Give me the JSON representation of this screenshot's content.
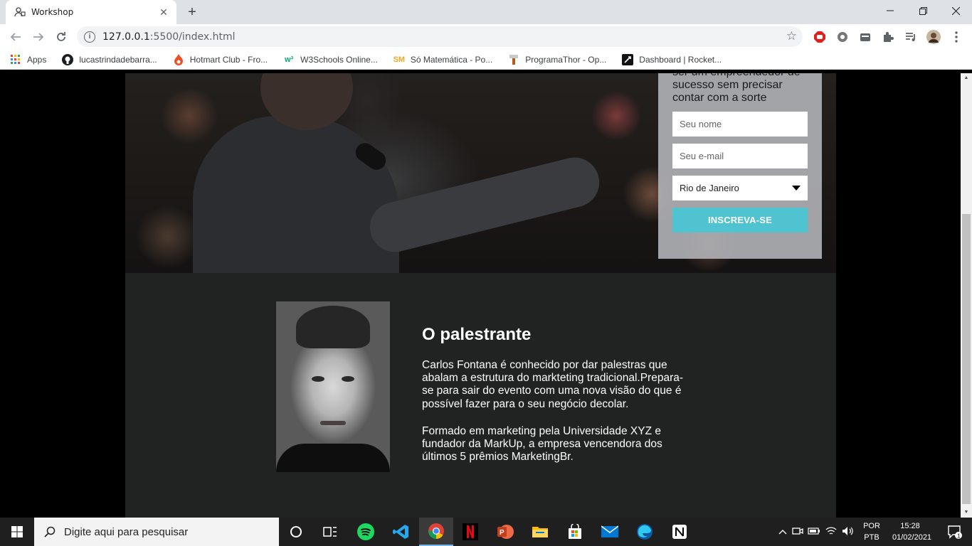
{
  "browser": {
    "tab_title": "Workshop",
    "new_tab_symbol": "+",
    "url_host": "127.0.0.1",
    "url_path": ":5500/index.html"
  },
  "bookmarks": [
    {
      "label": "Apps",
      "icon": "apps-grid-icon"
    },
    {
      "label": "lucastrindadebarra...",
      "icon": "github-icon"
    },
    {
      "label": "Hotmart Club - Fro...",
      "icon": "hotmart-icon"
    },
    {
      "label": "W3Schools Online...",
      "icon": "w3schools-icon"
    },
    {
      "label": "Só Matemática - Po...",
      "icon": "so-matematica-icon"
    },
    {
      "label": "ProgramaThor - Op...",
      "icon": "programathor-icon"
    },
    {
      "label": "Dashboard | Rocket...",
      "icon": "rocketseat-icon"
    }
  ],
  "signup_form": {
    "headline": "ser um empreendedor de sucesso sem precisar contar com a sorte",
    "name_placeholder": "Seu nome",
    "email_placeholder": "Seu e-mail",
    "city_selected": "Rio de Janeiro",
    "submit_label": "INSCREVA-SE",
    "accent_color": "#4fc3cf"
  },
  "speaker": {
    "title": "O palestrante",
    "paragraph_1": "Carlos Fontana é conhecido por dar palestras que abalam a estrutura do markteting tradicional.Prepara-se para sair do evento com uma nova visão do que é possível fazer para o seu negócio decolar.",
    "paragraph_2": "Formado em marketing pela Universidade XYZ e fundador da MarkUp, a empresa vencendora dos últimos 5 prêmios MarketingBr."
  },
  "taskbar": {
    "search_placeholder": "Digite aqui para pesquisar",
    "lang_line1": "POR",
    "lang_line2": "PTB",
    "time": "15:28",
    "date": "01/02/2021",
    "notification_count": "1"
  }
}
